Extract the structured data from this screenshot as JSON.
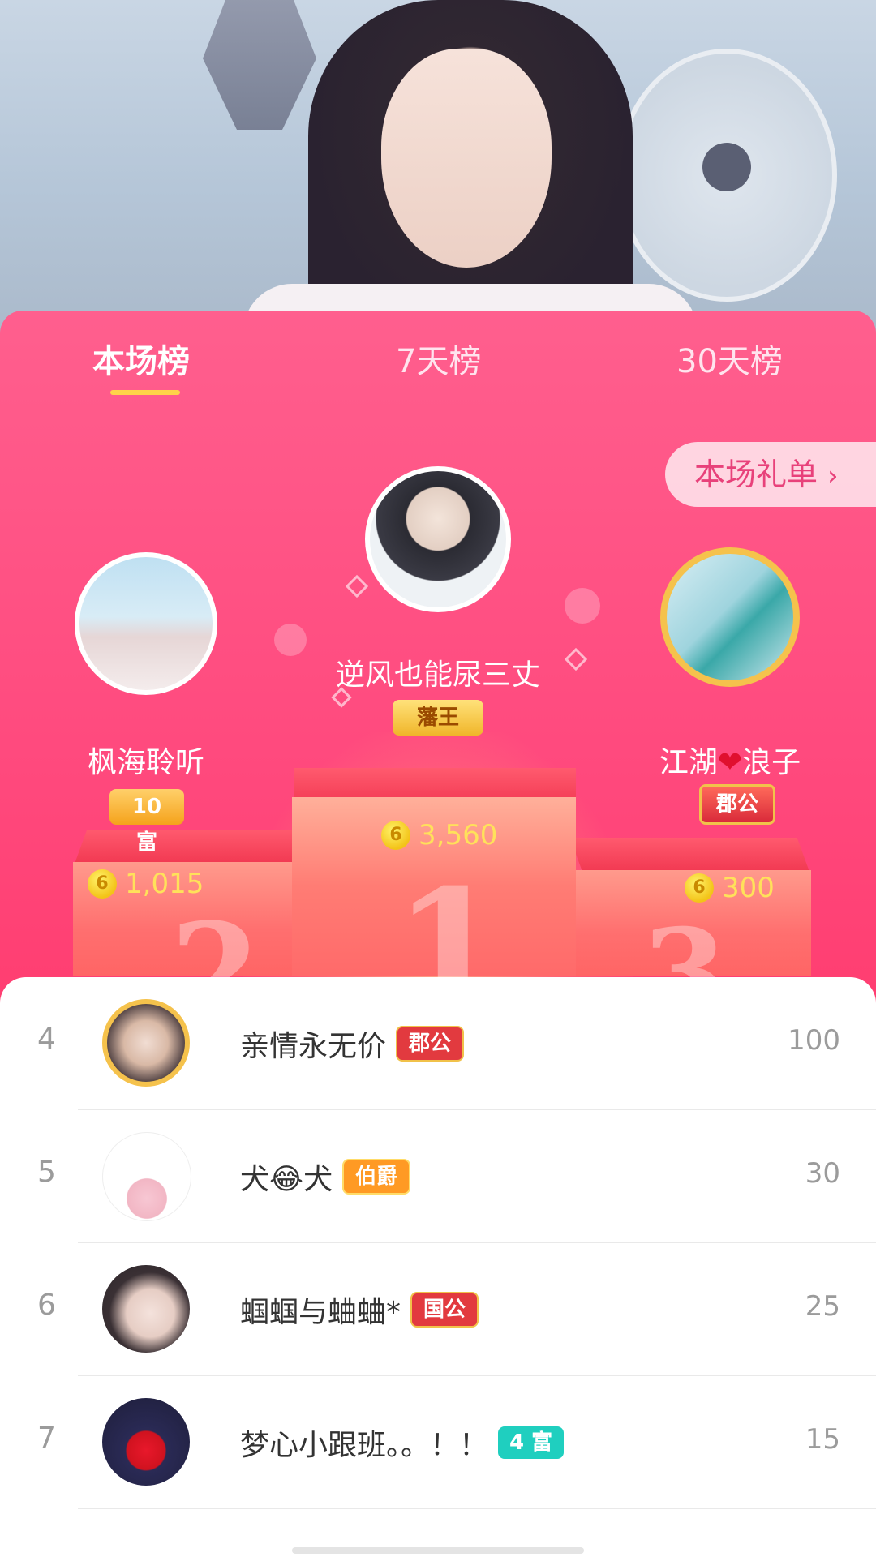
{
  "tabs": [
    {
      "label": "本场榜",
      "active": true
    },
    {
      "label": "7天榜",
      "active": false
    },
    {
      "label": "30天榜",
      "active": false
    }
  ],
  "gift_button": {
    "label": "本场礼单",
    "chevron": "›"
  },
  "podium": {
    "first": {
      "rank": "1",
      "name": "逆风也能尿三丈",
      "badge": "藩王",
      "coins": "3,560"
    },
    "second": {
      "rank": "2",
      "name": "枫海聆听",
      "badge": "10 富",
      "coins": "1,015"
    },
    "third": {
      "rank": "3",
      "name_part1": "江湖",
      "heart": "❤",
      "name_part2": "浪子",
      "badge": "郡公",
      "coins": "300"
    }
  },
  "coin_glyph": "6",
  "list": [
    {
      "rank": "4",
      "name": "亲情永无价",
      "badge": "郡公",
      "badge_color": "#e23a3f",
      "score": "100"
    },
    {
      "rank": "5",
      "name": "犬😂犬",
      "badge": "伯爵",
      "badge_color": "#ff9a24",
      "score": "30"
    },
    {
      "rank": "6",
      "name": "蝈蝈与蛐蛐*",
      "badge": "国公",
      "badge_color": "#e23a3f",
      "score": "25"
    },
    {
      "rank": "7",
      "name": "梦心小跟班。。！！",
      "badge": "4 富",
      "badge_color": "#1fcfbf",
      "score": "15"
    }
  ]
}
